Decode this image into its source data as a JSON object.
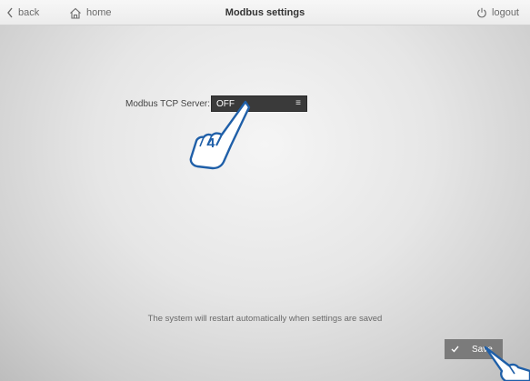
{
  "header": {
    "back_label": "back",
    "home_label": "home",
    "title": "Modbus settings",
    "logout_label": "logout"
  },
  "form": {
    "modbus_tcp_label": "Modbus TCP Server:",
    "modbus_tcp_value": "OFF"
  },
  "annotation": {
    "step_number": "4"
  },
  "footer": {
    "notice": "The system will restart automatically when settings are saved",
    "save_label": "Save"
  },
  "icons": {
    "back": "chevron-left-icon",
    "home": "house-icon",
    "logout": "power-icon",
    "select": "menu-lines-icon",
    "save": "checkmark-icon",
    "pointer": "pointing-hand-icon"
  },
  "colors": {
    "select_bg": "#3a3a3a",
    "save_bg": "#7b7b7b",
    "annotation_blue": "#1f5fa8"
  }
}
